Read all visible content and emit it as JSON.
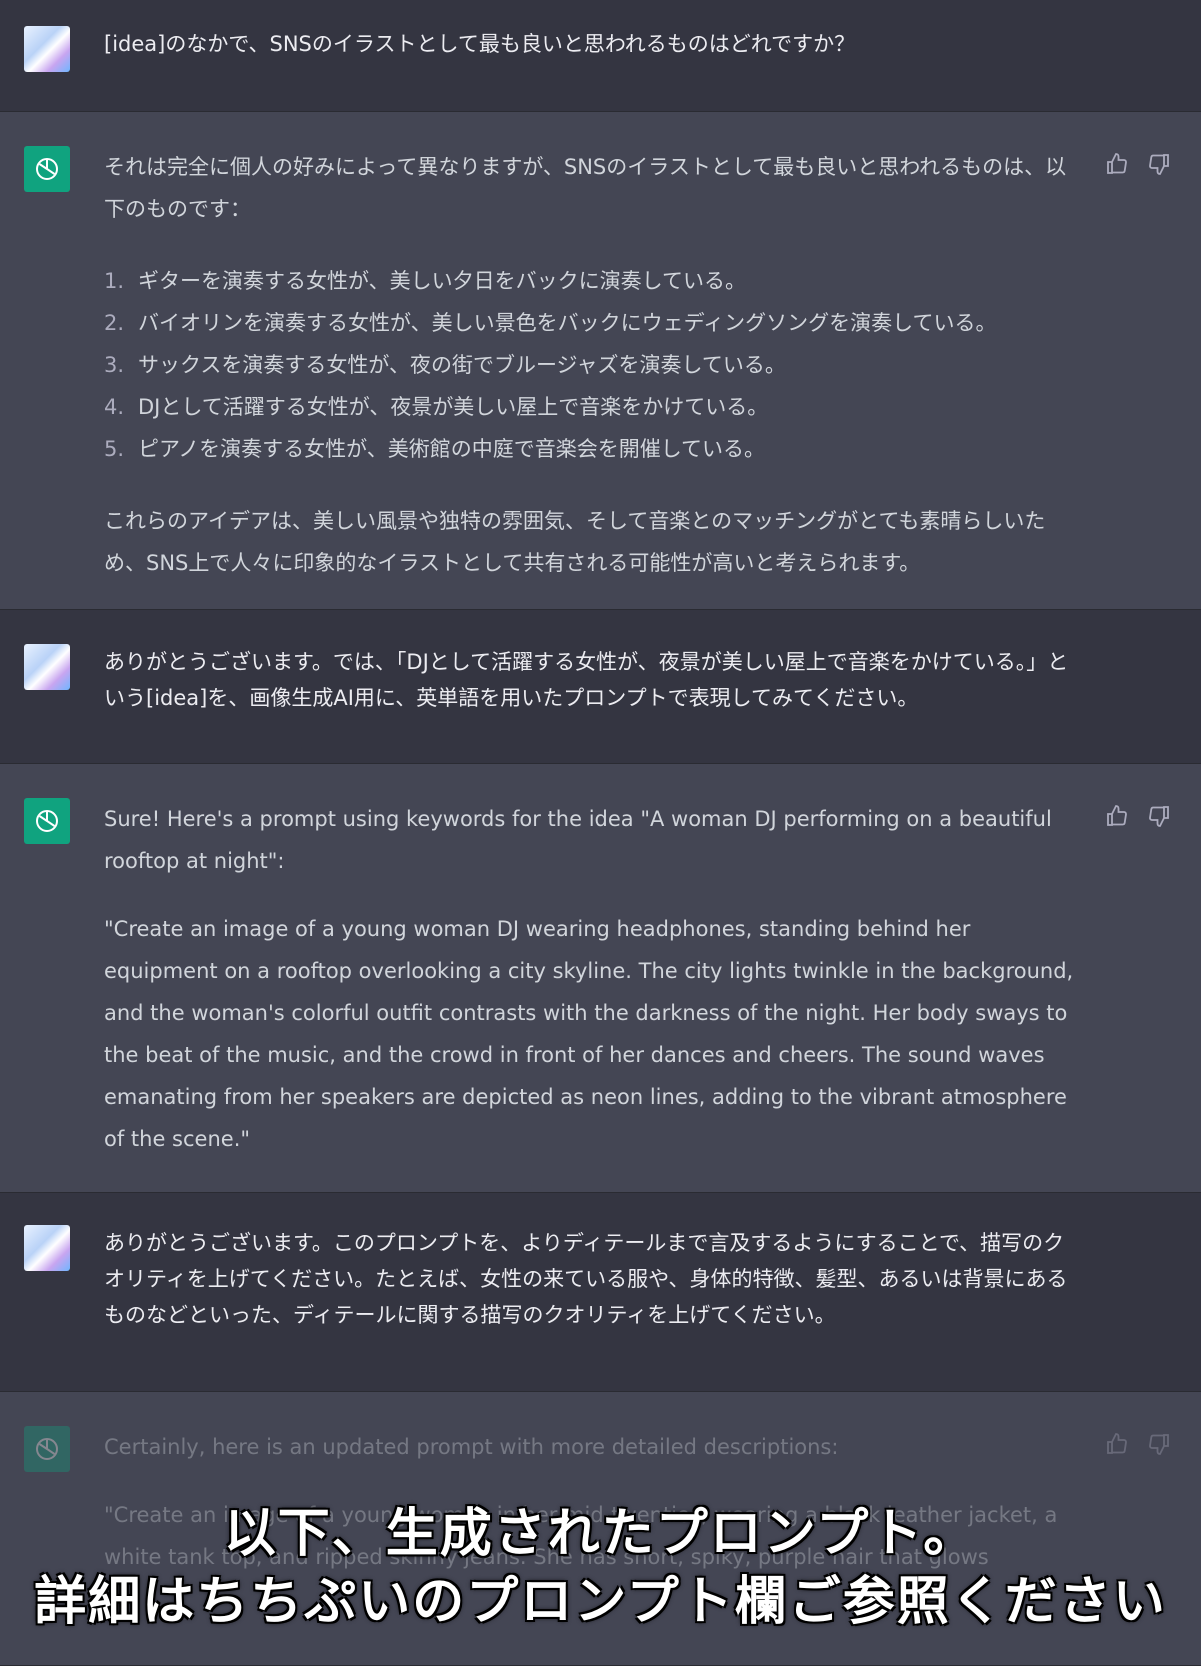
{
  "messages": [
    {
      "role": "user",
      "text": "[idea]のなかで、SNSのイラストとして最も良いと思われるものはどれですか？"
    },
    {
      "role": "assistant",
      "intro": "それは完全に個人の好みによって異なりますが、SNSのイラストとして最も良いと思われるものは、以下のものです：",
      "list": [
        {
          "n": "1.",
          "text": "ギターを演奏する女性が、美しい夕日をバックに演奏している。"
        },
        {
          "n": "2.",
          "text": "バイオリンを演奏する女性が、美しい景色をバックにウェディングソングを演奏している。"
        },
        {
          "n": "3.",
          "text": "サックスを演奏する女性が、夜の街でブルージャズを演奏している。"
        },
        {
          "n": "4.",
          "text": "DJとして活躍する女性が、夜景が美しい屋上で音楽をかけている。"
        },
        {
          "n": "5.",
          "text": "ピアノを演奏する女性が、美術館の中庭で音楽会を開催している。"
        }
      ],
      "outro": "これらのアイデアは、美しい風景や独特の雰囲気、そして音楽とのマッチングがとても素晴らしいため、SNS上で人々に印象的なイラストとして共有される可能性が高いと考えられます。"
    },
    {
      "role": "user",
      "text": "ありがとうございます。では、「DJとして活躍する女性が、夜景が美しい屋上で音楽をかけている。」という[idea]を、画像生成AI用に、英単語を用いたプロンプトで表現してみてください。"
    },
    {
      "role": "assistant",
      "intro": "Sure! Here's a prompt using keywords for the idea \"A woman DJ performing on a beautiful rooftop at night\":",
      "body": "\"Create an image of a young woman DJ wearing headphones, standing behind her equipment on a rooftop overlooking a city skyline. The city lights twinkle in the background, and the woman's colorful outfit contrasts with the darkness of the night. Her body sways to the beat of the music, and the crowd in front of her dances and cheers. The sound waves emanating from her speakers are depicted as neon lines, adding to the vibrant atmosphere of the scene.\""
    },
    {
      "role": "user",
      "text": "ありがとうございます。このプロンプトを、よりディテールまで言及するようにすることで、描写のクオリティを上げてください。たとえば、女性の来ている服や、身体的特徴、髪型、あるいは背景にあるものなどといった、ディテールに関する描写のクオリティを上げてください。"
    },
    {
      "role": "assistant",
      "intro": "Certainly, here is an updated prompt with more detailed descriptions:",
      "body": "\"Create an image of a young woman in her mid-twenties, wearing a black leather jacket, a white tank top, and ripped skinny jeans. She has short, spiky, purple hair that glows"
    }
  ],
  "overlay": {
    "line1": "以下、生成されたプロンプト。",
    "line2": "詳細はちちぷいのプロンプト欄ご参照ください"
  },
  "icons": {
    "like": "thumbs-up-icon",
    "dislike": "thumbs-down-icon",
    "bot": "openai-logo-icon"
  },
  "colors": {
    "user_bg": "#343541",
    "bot_bg": "#444654",
    "bot_avatar": "#10a37f"
  }
}
